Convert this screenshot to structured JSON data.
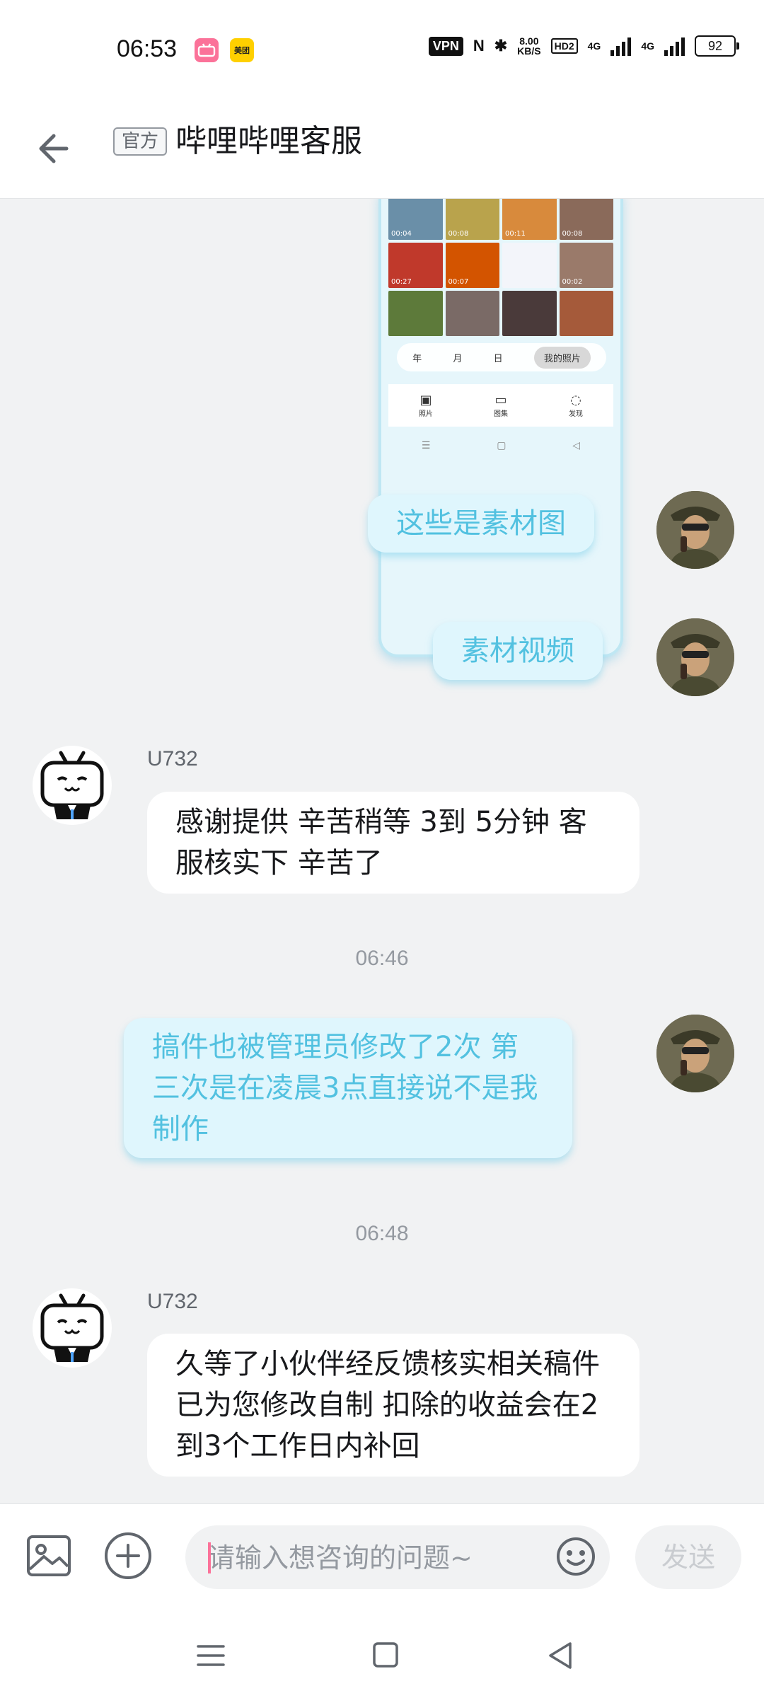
{
  "status_bar": {
    "time": "06:53",
    "app_icon_bilibili": "bilibili",
    "app_icon_meituan": "美团",
    "vpn": "VPN",
    "nfc": "N",
    "bluetooth": "✱",
    "speed_value": "8.00",
    "speed_unit": "KB/S",
    "hd": "HD2",
    "net1": "4G",
    "net2": "4G",
    "battery": "92"
  },
  "header": {
    "back_icon": "arrow-left-icon",
    "official_badge": "官方",
    "title": "哔哩哔哩客服"
  },
  "shared_image": {
    "durations": [
      "00:04",
      "00:08",
      "00:11",
      "00:08",
      "00:27",
      "00:07",
      "00:02"
    ],
    "segments": [
      "年",
      "月",
      "日",
      "我的照片"
    ],
    "tabs": [
      "照片",
      "图集",
      "发现"
    ]
  },
  "messages": {
    "m1": {
      "text": "这些是素材图"
    },
    "m2": {
      "text": "素材视频"
    },
    "m3": {
      "sender": "U732",
      "text": "感谢提供 辛苦稍等 3到 5分钟 客服核实下   辛苦了"
    },
    "t1": "06:46",
    "m4": {
      "text": "搞件也被管理员修改了2次 第三次是在凌晨3点直接说不是我制作"
    },
    "t2": "06:48",
    "m5": {
      "sender": "U732",
      "text": "久等了小伙伴经反馈核实相关稿件已为您修改自制 扣除的收益会在2到3个工作日内补回"
    }
  },
  "input_bar": {
    "placeholder": "请输入想咨询的问题~",
    "send_label": "发送"
  },
  "colors": {
    "accent": "#fb7299",
    "bubble_out_bg": "#dff6fd",
    "bubble_out_text": "#52c1e0",
    "page_bg": "#f1f2f3"
  }
}
